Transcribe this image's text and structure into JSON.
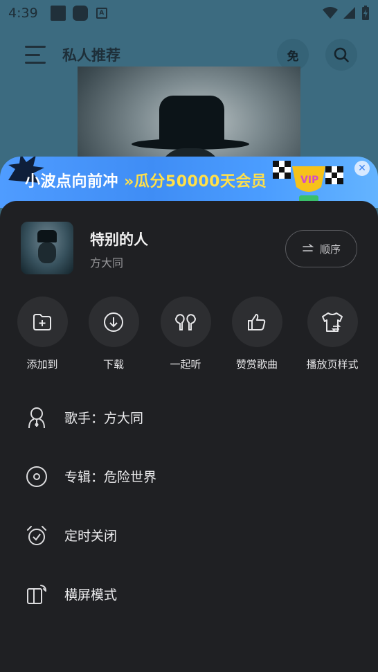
{
  "status_bar": {
    "time": "4:39"
  },
  "header": {
    "title": "私人推荐",
    "free_badge": "免"
  },
  "banner": {
    "text_main": "小波点向前冲 ",
    "arrows": "»",
    "text_highlight": "瓜分50000天会员",
    "trophy_text": "VIP"
  },
  "sheet": {
    "song": {
      "title": "特别的人",
      "artist": "方大同",
      "order_label": "顺序"
    },
    "actions": [
      {
        "label": "添加到",
        "icon": "folder-add-icon"
      },
      {
        "label": "下载",
        "icon": "download-icon"
      },
      {
        "label": "一起听",
        "icon": "earbuds-icon"
      },
      {
        "label": "赞赏歌曲",
        "icon": "thumbs-up-icon"
      },
      {
        "label": "播放页样式",
        "icon": "shirt-icon"
      }
    ],
    "menu": [
      {
        "label": "歌手：方大同",
        "icon": "singer-icon"
      },
      {
        "label": "专辑：危险世界",
        "icon": "album-icon"
      },
      {
        "label": "定时关闭",
        "icon": "alarm-icon"
      },
      {
        "label": "横屏模式",
        "icon": "landscape-icon"
      }
    ]
  },
  "colors": {
    "background": "#3c6b80",
    "sheet": "#1f2023",
    "banner": "#4f9cff",
    "highlight": "#ffe04a"
  }
}
